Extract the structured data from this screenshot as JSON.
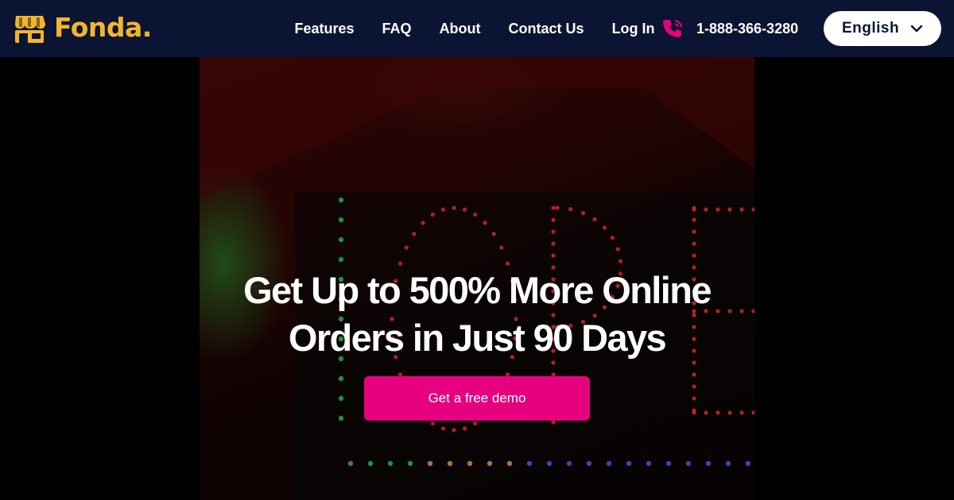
{
  "brand": {
    "name": "Fonda.",
    "logo_color": "#f4b52a",
    "logo_icon": "storefront-icon"
  },
  "nav": {
    "links": [
      "Features",
      "FAQ",
      "About",
      "Contact Us",
      "Log In"
    ],
    "phone_icon": "phone-icon",
    "phone": "1-888-366-3280",
    "language": "English",
    "background": "#0b1533"
  },
  "hero": {
    "headline_line1": "Get Up to 500% More Online",
    "headline_line2": "Orders in Just 90 Days",
    "cta_label": "Get a free demo",
    "cta_color": "#e6007e",
    "background_image": "neon-open-sign"
  },
  "colors": {
    "accent_pink": "#e6007e",
    "brand_yellow": "#f4b52a",
    "navy": "#0b1533"
  }
}
